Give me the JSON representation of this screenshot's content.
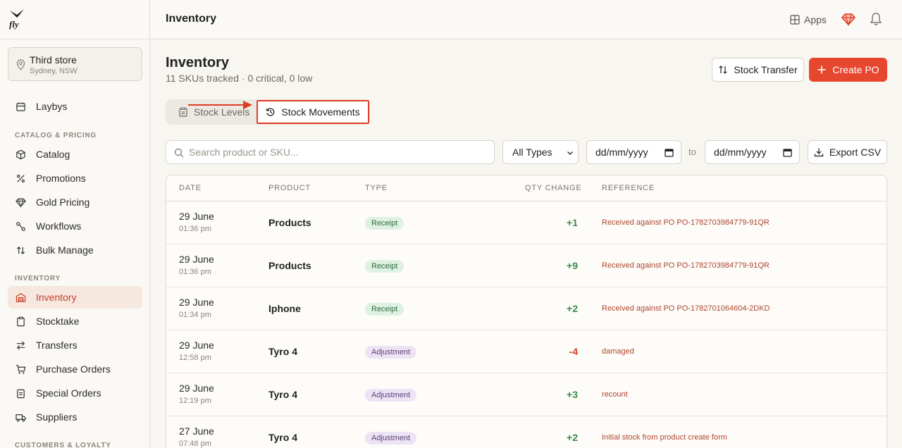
{
  "brand": {
    "logo_text": "fly"
  },
  "store": {
    "name": "Third store",
    "location": "Sydney, NSW"
  },
  "sidebar": {
    "top_items": [
      {
        "label": "Laybys",
        "icon": "calendar-icon"
      }
    ],
    "catalog_section": "CATALOG & PRICING",
    "catalog_items": [
      {
        "label": "Catalog",
        "icon": "box-icon"
      },
      {
        "label": "Promotions",
        "icon": "percent-icon"
      },
      {
        "label": "Gold Pricing",
        "icon": "gem-icon"
      },
      {
        "label": "Workflows",
        "icon": "workflow-icon"
      },
      {
        "label": "Bulk Manage",
        "icon": "sort-arrows-icon"
      }
    ],
    "inventory_section": "INVENTORY",
    "inventory_items": [
      {
        "label": "Inventory",
        "icon": "warehouse-icon",
        "active": true
      },
      {
        "label": "Stocktake",
        "icon": "clipboard-icon"
      },
      {
        "label": "Transfers",
        "icon": "transfer-icon"
      },
      {
        "label": "Purchase Orders",
        "icon": "cart-icon"
      },
      {
        "label": "Special Orders",
        "icon": "clipboard-list-icon"
      },
      {
        "label": "Suppliers",
        "icon": "truck-icon"
      }
    ],
    "customers_section": "CUSTOMERS & LOYALTY"
  },
  "header": {
    "title": "Inventory",
    "apps_label": "Apps"
  },
  "page": {
    "title": "Inventory",
    "subtitle": "11 SKUs tracked · 0 critical, 0 low",
    "stock_transfer_label": "Stock Transfer",
    "create_po_label": "Create PO"
  },
  "tabs": {
    "levels": "Stock Levels",
    "movements": "Stock Movements"
  },
  "filters": {
    "search_placeholder": "Search product or SKU...",
    "type_value": "All Types",
    "date_placeholder": "dd/mm/yyyy",
    "to_label": "to",
    "export_label": "Export CSV"
  },
  "table": {
    "columns": {
      "date": "DATE",
      "product": "PRODUCT",
      "type": "TYPE",
      "qty": "QTY CHANGE",
      "reference": "REFERENCE"
    },
    "rows": [
      {
        "date": "29 June",
        "time": "01:36 pm",
        "product": "Products",
        "type": "Receipt",
        "qty": "+1",
        "reference": "Received against PO PO-1782703984779-91QR"
      },
      {
        "date": "29 June",
        "time": "01:36 pm",
        "product": "Products",
        "type": "Receipt",
        "qty": "+9",
        "reference": "Received against PO PO-1782703984779-91QR"
      },
      {
        "date": "29 June",
        "time": "01:34 pm",
        "product": "Iphone",
        "type": "Receipt",
        "qty": "+2",
        "reference": "Received against PO PO-1782701064604-2DKD"
      },
      {
        "date": "29 June",
        "time": "12:58 pm",
        "product": "Tyro 4",
        "type": "Adjustment",
        "qty": "-4",
        "reference": "damaged"
      },
      {
        "date": "29 June",
        "time": "12:19 pm",
        "product": "Tyro 4",
        "type": "Adjustment",
        "qty": "+3",
        "reference": "recount"
      },
      {
        "date": "27 June",
        "time": "07:48 pm",
        "product": "Tyro 4",
        "type": "Adjustment",
        "qty": "+2",
        "reference": "Initial stock from product create form"
      }
    ]
  },
  "colors": {
    "accent": "#e8472f",
    "active_bg": "#f6e7df",
    "receipt_bg": "#dff1e3",
    "adjust_bg": "#ece3f4"
  }
}
